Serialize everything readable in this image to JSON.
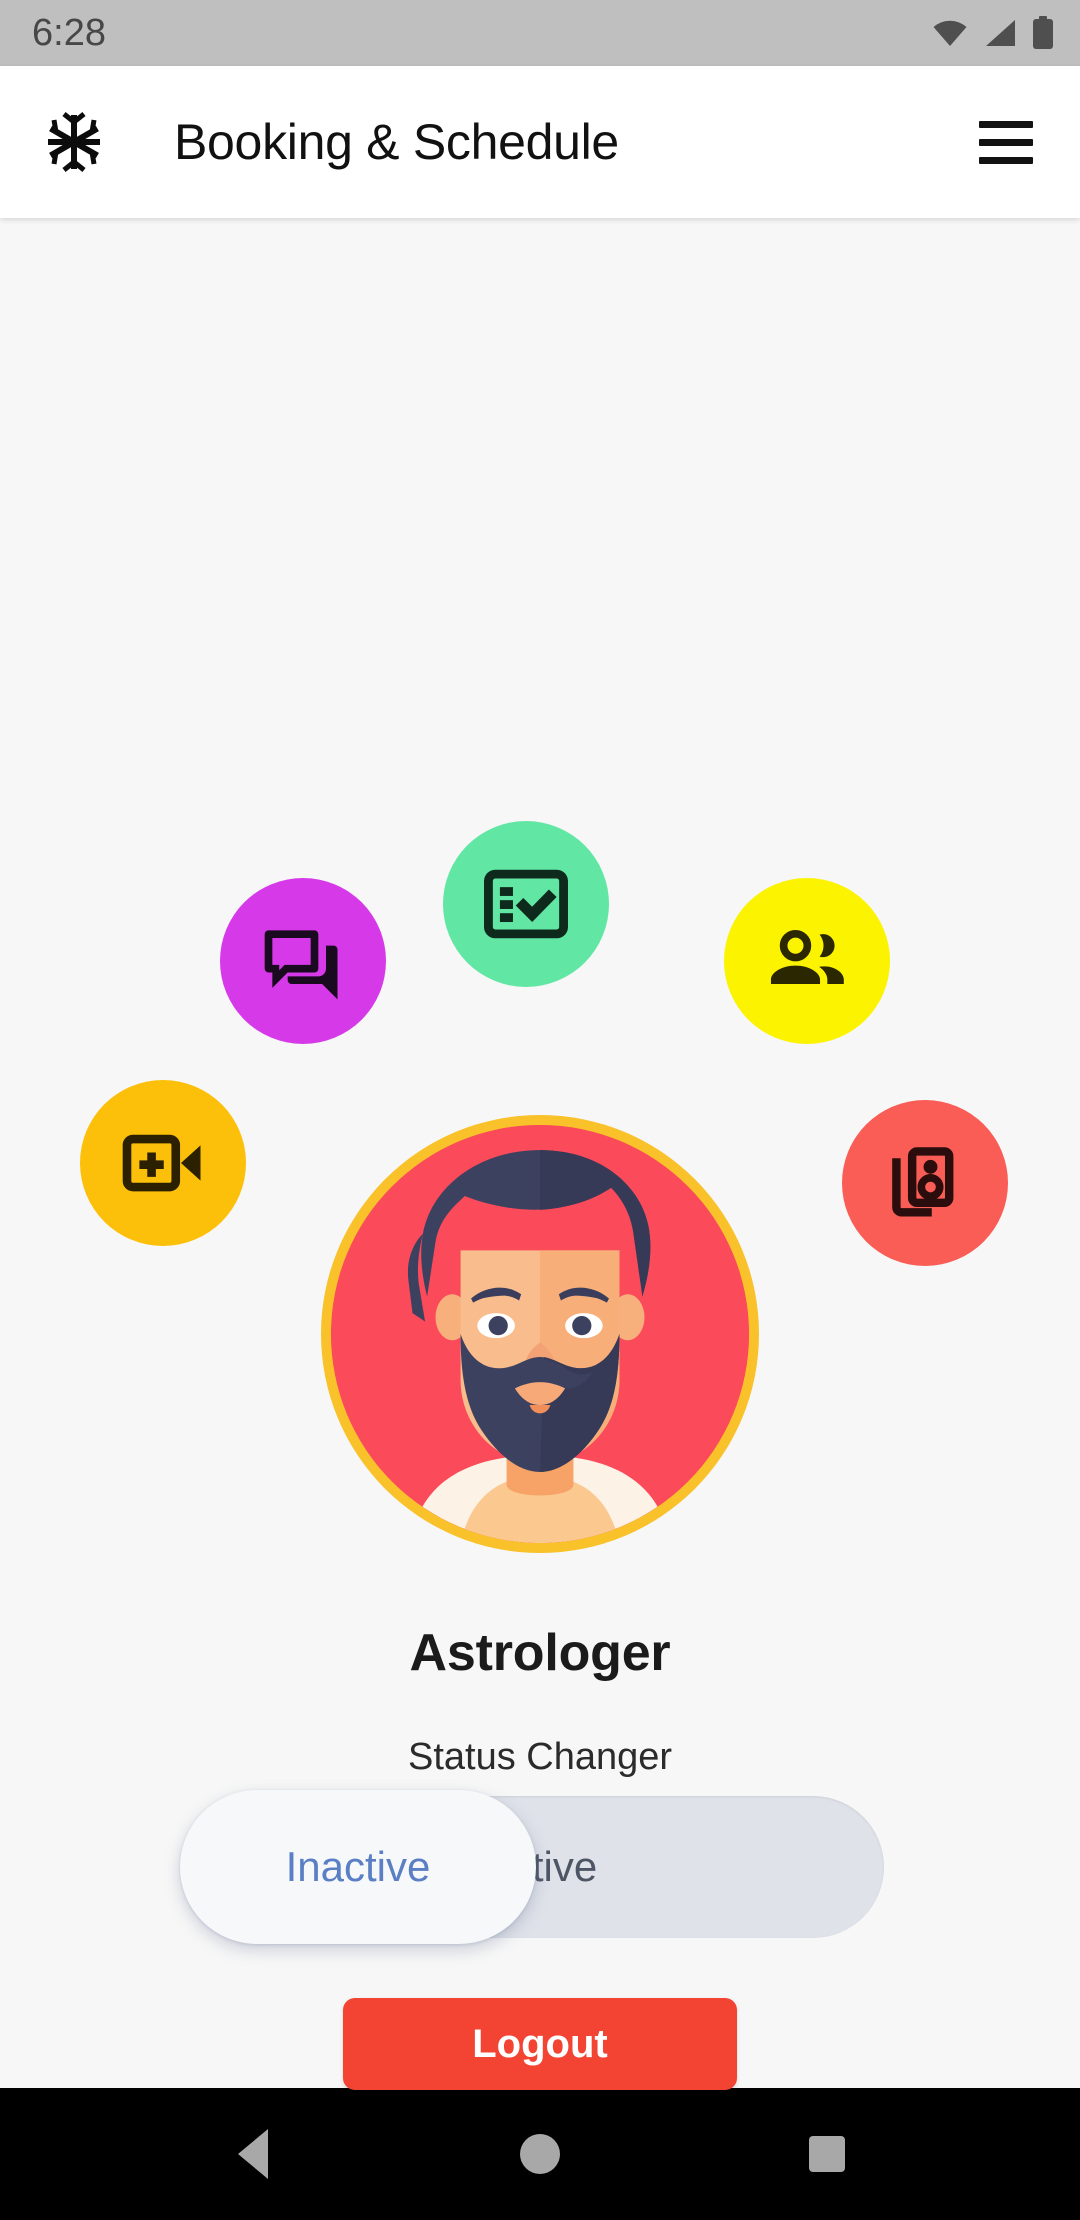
{
  "status_bar": {
    "time": "6:28",
    "icons": [
      "wifi-icon",
      "cellular-signal-icon",
      "battery-icon"
    ]
  },
  "app_bar": {
    "logo_icon": "snowflake-logo-icon",
    "title": "Booking & Schedule",
    "menu_icon": "hamburger-menu-icon"
  },
  "quick_actions": [
    {
      "id": "chat",
      "icon": "chat-forum-icon",
      "color": "#d63ae8",
      "label": "Chat"
    },
    {
      "id": "tasks",
      "icon": "checklist-task-icon",
      "color": "#62e6a4",
      "label": "Tasks"
    },
    {
      "id": "people",
      "icon": "people-group-icon",
      "color": "#fbf300",
      "label": "People"
    },
    {
      "id": "video",
      "icon": "video-call-add-icon",
      "color": "#fcc00a",
      "label": "Video Call"
    },
    {
      "id": "speaker",
      "icon": "speaker-group-icon",
      "color": "#fa5d55",
      "label": "Speaker"
    }
  ],
  "profile": {
    "avatar_icon": "bearded-man-avatar",
    "avatar_ring_color": "#f9c22b",
    "avatar_bg_color": "#fb4a59",
    "name": "Astrologer"
  },
  "status_changer": {
    "label": "Status Changer",
    "options": [
      "Inactive",
      "Active"
    ],
    "selected": "Inactive",
    "selected_text_color": "#5a7fc4",
    "unselected_text_color": "#4e5666",
    "track_color": "#dfe2e9"
  },
  "logout": {
    "label": "Logout",
    "color": "#f24333"
  },
  "nav_bar": {
    "back_icon": "back-triangle-icon",
    "home_icon": "home-circle-icon",
    "recents_icon": "recents-square-icon"
  }
}
